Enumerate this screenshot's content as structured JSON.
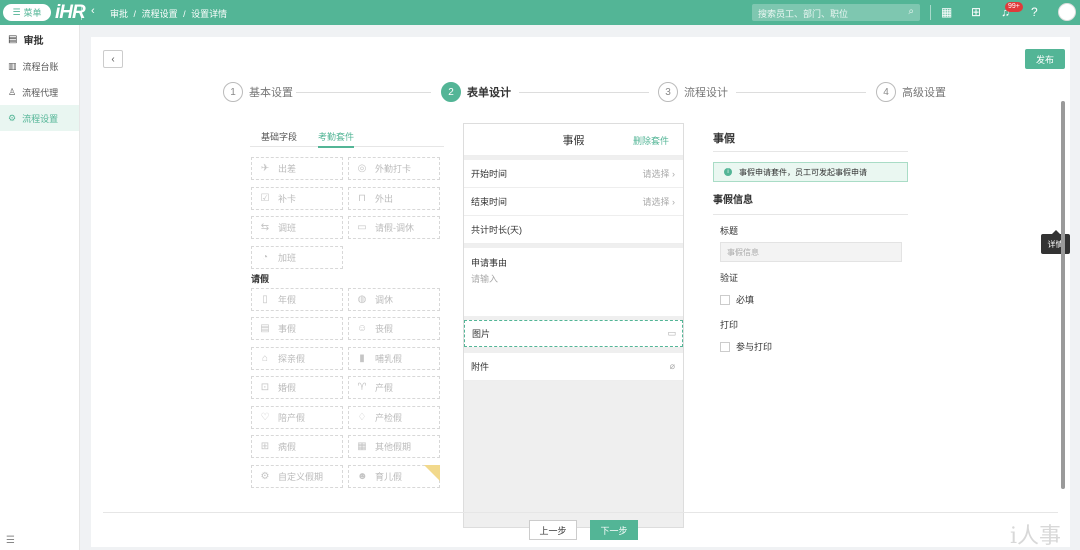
{
  "topbar": {
    "menu_label": "菜单",
    "logo_text": "iHR",
    "breadcrumb": [
      "审批",
      "/",
      "流程设置",
      "/",
      "设置详情"
    ],
    "search_placeholder": "搜索员工、部门、职位",
    "notification_count": "99+"
  },
  "sidebar": {
    "header": "审批",
    "items": [
      {
        "label": "流程台账",
        "icon": "ledger-icon"
      },
      {
        "label": "流程代理",
        "icon": "person-icon"
      },
      {
        "label": "流程设置",
        "icon": "gear-icon",
        "active": true
      }
    ],
    "footer_icon": "menu-icon"
  },
  "page": {
    "publish_label": "发布",
    "steps": [
      {
        "num": "1",
        "label": "基本设置",
        "active": false
      },
      {
        "num": "2",
        "label": "表单设计",
        "active": true
      },
      {
        "num": "3",
        "label": "流程设计",
        "active": false
      },
      {
        "num": "4",
        "label": "高级设置",
        "active": false
      }
    ],
    "prev_label": "上一步",
    "next_label": "下一步",
    "tooltip": "详情"
  },
  "fields": {
    "tabs": [
      "基础字段",
      "考勤套件"
    ],
    "active_tab": "考勤套件",
    "attendance": [
      "出差",
      "外勤打卡",
      "补卡",
      "外出",
      "调班",
      "请假-调休",
      "加班"
    ],
    "leave_section": "请假",
    "leave": [
      "年假",
      "调休",
      "事假",
      "丧假",
      "探亲假",
      "哺乳假",
      "婚假",
      "产假",
      "陪产假",
      "产检假",
      "病假",
      "其他假期",
      "自定义假期",
      "育儿假"
    ]
  },
  "form": {
    "title": "事假",
    "delete_label": "删除套件",
    "start_label": "开始时间",
    "end_label": "结束时间",
    "select_hint": "请选择",
    "duration_label": "共计时长(天)",
    "reason_label": "申请事由",
    "reason_placeholder": "请输入",
    "image_label": "图片",
    "attachment_label": "附件"
  },
  "props": {
    "title": "事假",
    "notice": "事假申请套件，员工可发起事假申请",
    "section": "事假信息",
    "title_label": "标题",
    "title_value": "事假信息",
    "validate_label": "验证",
    "required_label": "必填",
    "print_label": "打印",
    "print_option": "参与打印"
  },
  "colors": {
    "brand": "#53b596",
    "badge": "#e03b3b"
  },
  "watermark": "i人事"
}
